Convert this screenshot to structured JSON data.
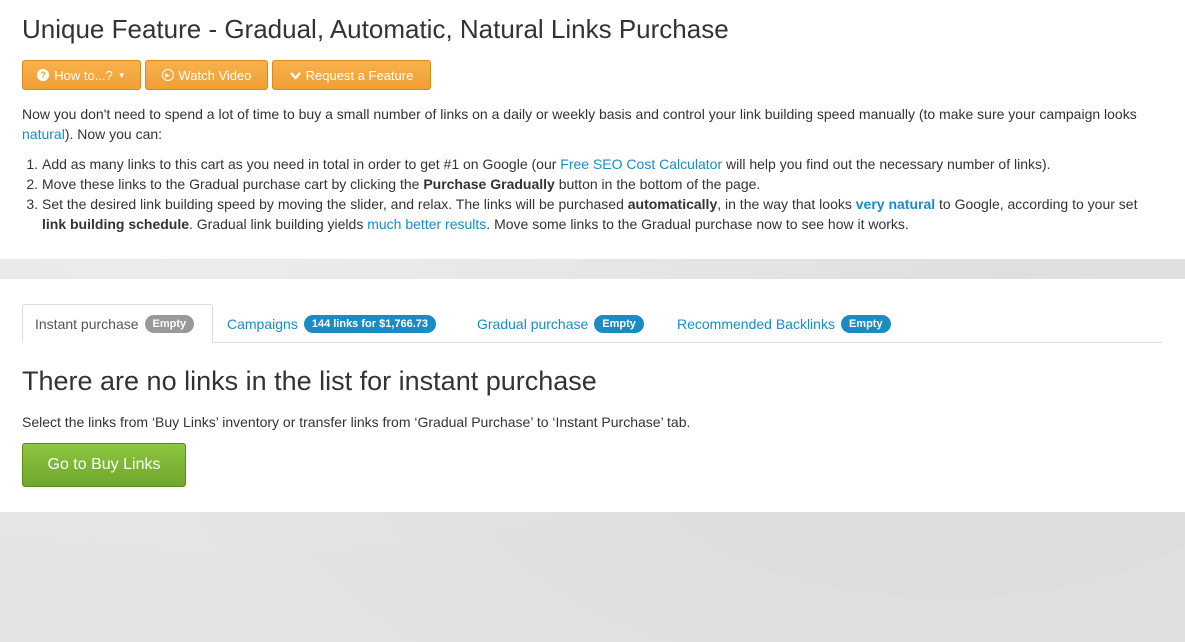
{
  "header": {
    "title": "Unique Feature - Gradual, Automatic, Natural Links Purchase",
    "buttons": {
      "how_to": "How to...?",
      "watch_video": "Watch Video",
      "request_feature": "Request a Feature"
    },
    "colors": {
      "accent_orange": "#f0a035",
      "link_blue": "#1b8bc4"
    }
  },
  "intro": {
    "text_before": "Now you don't need to spend a lot of time to buy a small number of links on a daily or weekly basis and control your link building speed manually (to make sure your campaign looks ",
    "natural_link": "natural",
    "text_after": "). Now you can:"
  },
  "steps": [
    {
      "num": "1.",
      "a": "Add as many links to this cart as you need in total in order to get #1 on Google (our ",
      "link": "Free SEO Cost Calculator",
      "b": " will help you find out the necessary number of links)."
    },
    {
      "num": "2.",
      "a": "Move these links to the Gradual purchase cart by clicking the ",
      "bold": "Purchase Gradually",
      "b": " button in the bottom of the page."
    },
    {
      "num": "3.",
      "a": "Set the desired link building speed by moving the slider, and relax. The links will be purchased ",
      "bold1": "automatically",
      "b": ", in the way that looks ",
      "bold_link": "very natural",
      "c": " to Google, according to your set ",
      "bold2": "link building schedule",
      "d": ". Gradual link building yields ",
      "link": "much better results",
      "e": ". Move some links to the Gradual purchase now to see how it works."
    }
  ],
  "tabs": [
    {
      "label": "Instant purchase",
      "badge": "Empty"
    },
    {
      "label": "Campaigns",
      "badge": "144 links for $1,766.73"
    },
    {
      "label": "Gradual purchase",
      "badge": "Empty"
    },
    {
      "label": "Recommended Backlinks",
      "badge": "Empty"
    }
  ],
  "main": {
    "title": "There are no links in the list for instant purchase",
    "description": "Select the links from ‘Buy Links’ inventory or transfer links from ‘Gradual Purchase’ to ‘Instant Purchase’ tab.",
    "button": "Go to Buy Links"
  }
}
